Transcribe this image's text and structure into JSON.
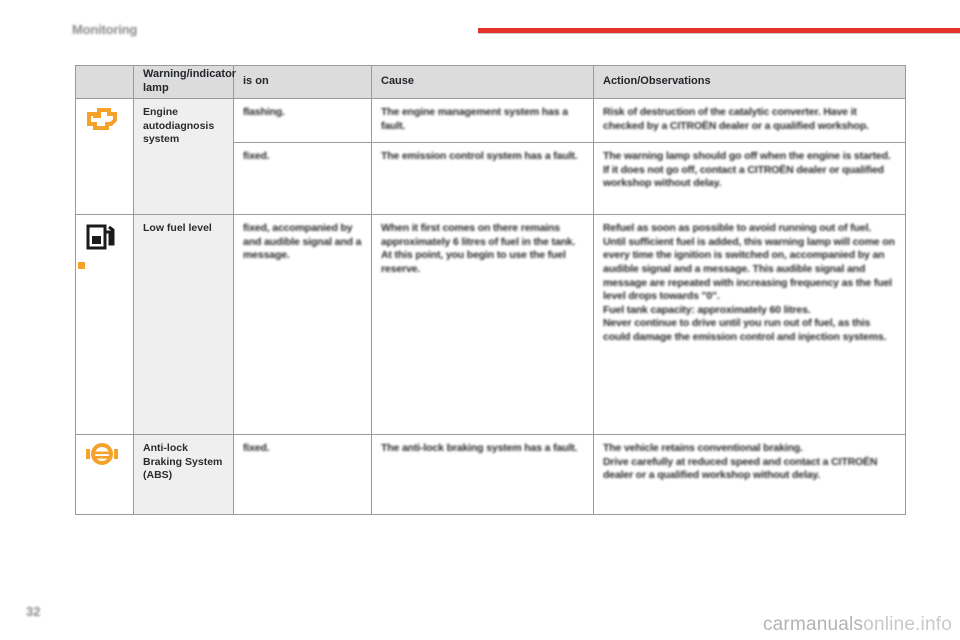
{
  "header": {
    "chapter_title": "Monitoring",
    "rule_color": "#e63329"
  },
  "table": {
    "columns": [
      {
        "key": "icon",
        "label": ""
      },
      {
        "key": "lamp",
        "label": "Warning/indicator lamp"
      },
      {
        "key": "ison",
        "label": "is on"
      },
      {
        "key": "cause",
        "label": "Cause"
      },
      {
        "key": "action",
        "label": "Action/Observations"
      }
    ],
    "rows": [
      {
        "icon_name": "engine-autodiagnosis-icon",
        "icon_color": "#f5a12a",
        "lamp": "Engine autodiagnosis system",
        "ison": "flashing.",
        "cause": "The engine management system has a fault.",
        "action": "Risk of destruction of the catalytic converter. Have it checked by a CITROËN dealer or a qualified workshop."
      },
      {
        "icon_name": "",
        "icon_color": "",
        "lamp": "",
        "ison": "fixed.",
        "cause": "The emission control system has a fault.",
        "action": "The warning lamp should go off when the engine is started. If it does not go off, contact a CITROËN dealer or qualified workshop without delay."
      },
      {
        "icon_name": "low-fuel-level-icon",
        "icon_color": "#f5a12a",
        "lamp": "Low fuel level",
        "ison": "fixed, accompanied by and audible signal and a message.",
        "cause": "When it first comes on there remains approximately 6 litres of fuel in the tank.\nAt this point, you begin to use the fuel reserve.",
        "action": "Refuel as soon as possible to avoid running out of fuel.\nUntil sufficient fuel is added, this warning lamp will come on every time the ignition is switched on, accompanied by an audible signal and a message. This audible signal and message are repeated with increasing frequency as the fuel level drops towards \"0\".\nFuel tank capacity: approximately 60 litres.\nNever continue to drive until you run out of fuel, as this could damage the emission control and injection systems."
      },
      {
        "icon_name": "abs-icon",
        "icon_color": "#f5a12a",
        "lamp": "Anti-lock Braking System (ABS)",
        "ison": "fixed.",
        "cause": "The anti-lock braking system has a fault.",
        "action": "The vehicle retains conventional braking.\nDrive carefully at reduced speed and contact a CITROËN dealer or a qualified workshop without delay."
      }
    ]
  },
  "footer": {
    "page_number": "32",
    "watermark_prefix": "carmanuals",
    "watermark_suffix": "online.info"
  }
}
